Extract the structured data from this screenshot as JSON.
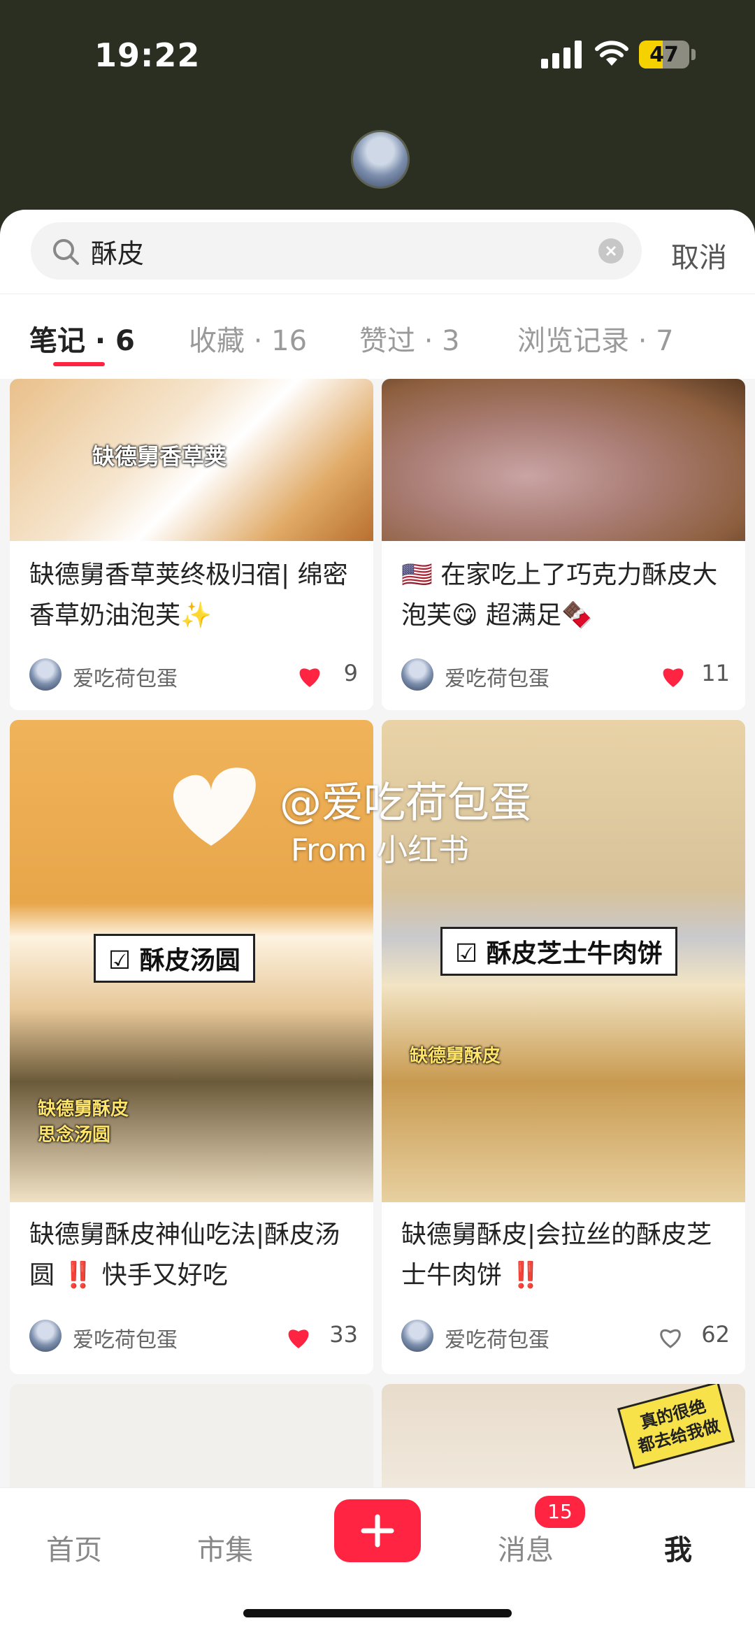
{
  "status_bar": {
    "time": "19:22",
    "battery": "47",
    "battery_level": 0.47
  },
  "search": {
    "query": "酥皮",
    "cancel_label": "取消"
  },
  "tabs": [
    {
      "label": "笔记 · 6"
    },
    {
      "label": "收藏 · 16"
    },
    {
      "label": "赞过 · 3"
    },
    {
      "label": "浏览记录 · 7"
    }
  ],
  "notes": [
    {
      "title": "缺德舅香草荚终极归宿| 绵密香草奶油泡芙✨",
      "author": "爱吃荷包蛋",
      "likes": "9",
      "liked": true,
      "overlay": "缺德舅香草荚"
    },
    {
      "title": "🇺🇸 在家吃上了巧克力酥皮大泡芙😋 超满足🍫",
      "author": "爱吃荷包蛋",
      "likes": "11",
      "liked": true
    },
    {
      "title": "缺德舅酥皮神仙吃法|酥皮汤圆 ‼️ 快手又好吃",
      "author": "爱吃荷包蛋",
      "likes": "33",
      "liked": true,
      "overlay_box": "☑ 酥皮汤圆",
      "overlay": "缺德舅酥皮\n思念汤圆"
    },
    {
      "title": "缺德舅酥皮|会拉丝的酥皮芝士牛肉饼 ‼️",
      "author": "爱吃荷包蛋",
      "likes": "62",
      "liked": false,
      "overlay_box": "☑ 酥皮芝士牛肉饼",
      "overlay": "缺德舅酥皮"
    },
    {
      "title": "",
      "author": "",
      "likes": ""
    },
    {
      "title": "",
      "author": "",
      "likes": "",
      "sticker": "真的很绝\n都去给我做"
    }
  ],
  "watermark": {
    "handle": "@爱吃荷包蛋",
    "source": "From 小红书"
  },
  "nav": {
    "home": "首页",
    "market": "市集",
    "messages": "消息",
    "messages_badge": "15",
    "me": "我"
  },
  "colors": {
    "accent": "#ff2442",
    "header_bg": "#2b2f22"
  }
}
